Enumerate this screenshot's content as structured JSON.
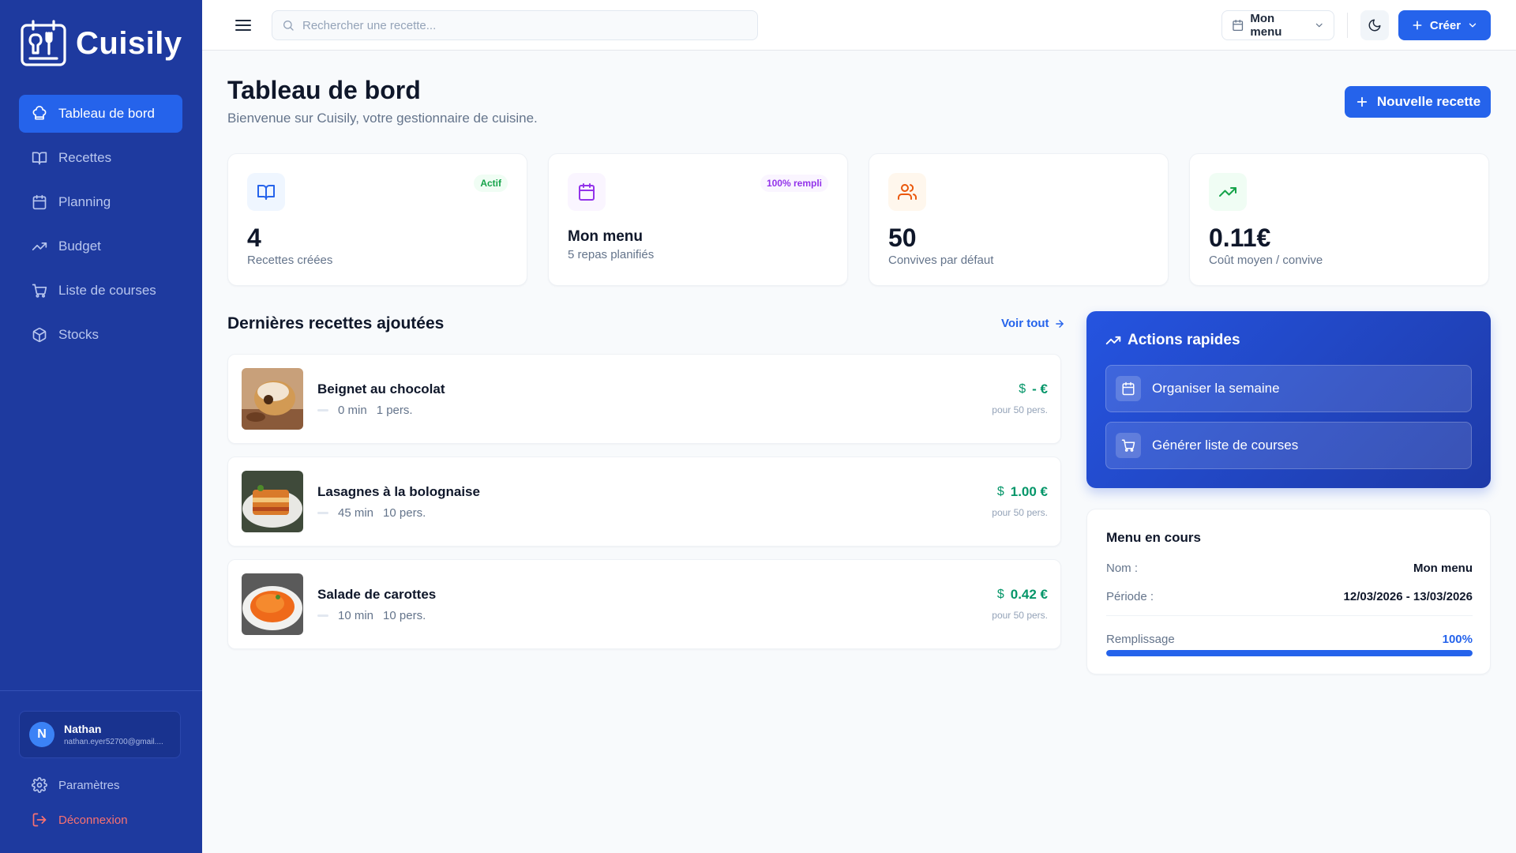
{
  "app": {
    "name": "Cuisily"
  },
  "sidebar": {
    "items": [
      {
        "label": "Tableau de bord",
        "icon": "chef-hat-icon",
        "active": true
      },
      {
        "label": "Recettes",
        "icon": "book-icon",
        "active": false
      },
      {
        "label": "Planning",
        "icon": "calendar-icon",
        "active": false
      },
      {
        "label": "Budget",
        "icon": "trending-up-icon",
        "active": false
      },
      {
        "label": "Liste de courses",
        "icon": "cart-icon",
        "active": false
      },
      {
        "label": "Stocks",
        "icon": "box-icon",
        "active": false
      }
    ],
    "user": {
      "initial": "N",
      "name": "Nathan",
      "email": "nathan.eyer52700@gmail...."
    },
    "settings_label": "Paramètres",
    "logout_label": "Déconnexion"
  },
  "topbar": {
    "search_placeholder": "Rechercher une recette...",
    "menu_select": "Mon menu",
    "create_label": "Créer"
  },
  "page": {
    "title": "Tableau de bord",
    "subtitle": "Bienvenue sur Cuisily, votre gestionnaire de cuisine.",
    "new_recipe_label": "Nouvelle recette"
  },
  "stats": [
    {
      "value": "4",
      "label": "Recettes créées",
      "badge": "Actif"
    },
    {
      "value": "Mon menu",
      "label": "5 repas planifiés",
      "badge": "100% rempli"
    },
    {
      "value": "50",
      "label": "Convives par défaut"
    },
    {
      "value": "0.11€",
      "label": "Coût moyen / convive"
    }
  ],
  "recent": {
    "title": "Dernières recettes ajoutées",
    "see_all": "Voir tout",
    "items": [
      {
        "name": "Beignet au chocolat",
        "time": "0 min",
        "people": "1 pers.",
        "price": "- €",
        "currency_symbol": "$",
        "per": "pour 50 pers."
      },
      {
        "name": "Lasagnes à la bolognaise",
        "time": "45 min",
        "people": "10 pers.",
        "price": "1.00 €",
        "currency_symbol": "$",
        "per": "pour 50 pers."
      },
      {
        "name": "Salade de carottes",
        "time": "10 min",
        "people": "10 pers.",
        "price": "0.42 €",
        "currency_symbol": "$",
        "per": "pour 50 pers."
      }
    ]
  },
  "quick_actions": {
    "title": "Actions rapides",
    "items": [
      {
        "label": "Organiser la semaine",
        "icon": "calendar-icon"
      },
      {
        "label": "Générer liste de courses",
        "icon": "cart-icon"
      }
    ]
  },
  "current_menu": {
    "title": "Menu en cours",
    "name_key": "Nom :",
    "name_value": "Mon menu",
    "period_key": "Période :",
    "period_value": "12/03/2026 - 13/03/2026",
    "fill_key": "Remplissage",
    "fill_value": "100%",
    "fill_fraction": 1.0
  },
  "colors": {
    "sidebar": "#1e3a9f",
    "accent": "#2563eb",
    "price_green": "#059669",
    "logout_red": "#f87171"
  }
}
